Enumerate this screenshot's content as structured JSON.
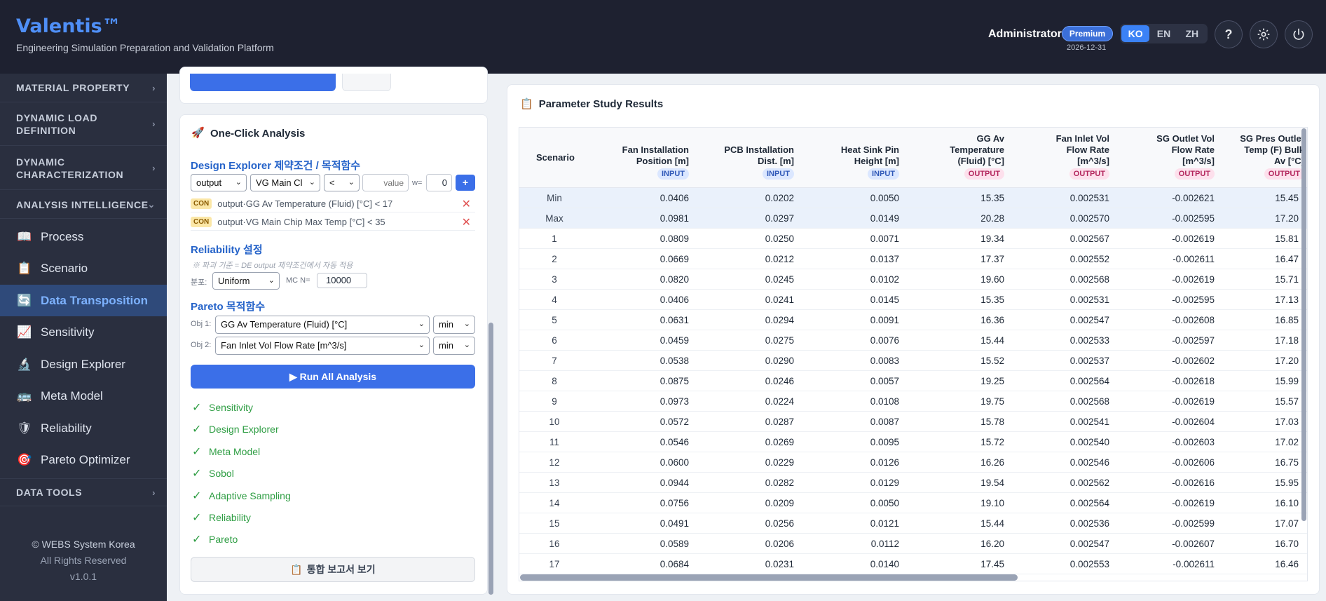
{
  "header": {
    "brand": "Valentis™",
    "subtitle": "Engineering Simulation Preparation and Validation Platform",
    "user": "Administrator",
    "plan_badge": "Premium",
    "plan_date": "2026-12-31",
    "languages": [
      "KO",
      "EN",
      "ZH"
    ],
    "active_language": "KO",
    "help_icon": "?",
    "settings_icon": "gear-icon",
    "power_icon": "power-icon"
  },
  "sidebar": {
    "sections": {
      "material": "MATERIAL PROPERTY",
      "dynamic_load": "DYNAMIC LOAD DEFINITION",
      "dynamic_char": "DYNAMIC CHARACTERIZATION",
      "analysis": "ANALYSIS INTELLIGENCE",
      "data_tools": "DATA TOOLS"
    },
    "items": [
      {
        "label": "Process",
        "icon": "book-icon"
      },
      {
        "label": "Scenario",
        "icon": "clipboard-icon"
      },
      {
        "label": "Data Transposition",
        "icon": "transpose-icon"
      },
      {
        "label": "Sensitivity",
        "icon": "chart-icon"
      },
      {
        "label": "Design Explorer",
        "icon": "microscope-icon"
      },
      {
        "label": "Meta Model",
        "icon": "bus-icon"
      },
      {
        "label": "Reliability",
        "icon": "shield-icon"
      },
      {
        "label": "Pareto Optimizer",
        "icon": "target-icon"
      }
    ],
    "active_item": "Data Transposition",
    "footer": {
      "copyright": "© WEBS System Korea",
      "rights": "All Rights Reserved",
      "version": "v1.0.1"
    }
  },
  "analysis_panel": {
    "title": "One-Click Analysis",
    "de": {
      "title": "Design Explorer 제약조건 / 목적함수",
      "type_select": "output",
      "var_select": "VG Main Cl",
      "op_select": "<",
      "value_placeholder": "value",
      "weight_label": "w=",
      "weight_value": "0",
      "add_label": "+"
    },
    "constraints": [
      {
        "badge": "CON",
        "text": "output·GG Av Temperature (Fluid) [°C] < 17"
      },
      {
        "badge": "CON",
        "text": "output·VG Main Chip Max Temp [°C] < 35"
      }
    ],
    "reliability": {
      "title": "Reliability 설정",
      "note": "※ 파괴 기준 = DE output 제약조건에서 자동 적용",
      "dist_label": "분포:",
      "dist_value": "Uniform",
      "mc_label": "MC N=",
      "mc_value": "10000"
    },
    "pareto": {
      "title": "Pareto 목적함수",
      "obj1_label": "Obj 1:",
      "obj1_value": "GG Av Temperature (Fluid) [°C]",
      "obj1_dir": "min",
      "obj2_label": "Obj 2:",
      "obj2_value": "Fan Inlet Vol Flow Rate [m^3/s]",
      "obj2_dir": "min"
    },
    "run_label": "▶ Run All Analysis",
    "checks": [
      "Sensitivity",
      "Design Explorer",
      "Meta Model",
      "Sobol",
      "Adaptive Sampling",
      "Reliability",
      "Pareto"
    ],
    "report_label": "통합 보고서 보기"
  },
  "results": {
    "title": "Parameter Study Results",
    "columns": [
      {
        "label": "Scenario",
        "tag": ""
      },
      {
        "label": "Fan Installation Position [m]",
        "tag": "INPUT"
      },
      {
        "label": "PCB Installation Dist. [m]",
        "tag": "INPUT"
      },
      {
        "label": "Heat Sink Pin Height [m]",
        "tag": "INPUT"
      },
      {
        "label": "GG Av Temperature (Fluid) [°C]",
        "tag": "OUTPUT"
      },
      {
        "label": "Fan Inlet Vol Flow Rate [m^3/s]",
        "tag": "OUTPUT"
      },
      {
        "label": "SG Outlet Vol Flow Rate [m^3/s]",
        "tag": "OUTPUT"
      },
      {
        "label": "SG Pres Outlet Temp (F) Bulk Av [°C]",
        "tag": "OUTPUT"
      }
    ],
    "stat_rows": [
      [
        "Min",
        "0.0406",
        "0.0202",
        "0.0050",
        "15.35",
        "0.002531",
        "-0.002621",
        "15.45"
      ],
      [
        "Max",
        "0.0981",
        "0.0297",
        "0.0149",
        "20.28",
        "0.002570",
        "-0.002595",
        "17.20"
      ]
    ],
    "rows": [
      [
        "1",
        "0.0809",
        "0.0250",
        "0.0071",
        "19.34",
        "0.002567",
        "-0.002619",
        "15.81"
      ],
      [
        "2",
        "0.0669",
        "0.0212",
        "0.0137",
        "17.37",
        "0.002552",
        "-0.002611",
        "16.47"
      ],
      [
        "3",
        "0.0820",
        "0.0245",
        "0.0102",
        "19.60",
        "0.002568",
        "-0.002619",
        "15.71"
      ],
      [
        "4",
        "0.0406",
        "0.0241",
        "0.0145",
        "15.35",
        "0.002531",
        "-0.002595",
        "17.13"
      ],
      [
        "5",
        "0.0631",
        "0.0294",
        "0.0091",
        "16.36",
        "0.002547",
        "-0.002608",
        "16.85"
      ],
      [
        "6",
        "0.0459",
        "0.0275",
        "0.0076",
        "15.44",
        "0.002533",
        "-0.002597",
        "17.18"
      ],
      [
        "7",
        "0.0538",
        "0.0290",
        "0.0083",
        "15.52",
        "0.002537",
        "-0.002602",
        "17.20"
      ],
      [
        "8",
        "0.0875",
        "0.0246",
        "0.0057",
        "19.25",
        "0.002564",
        "-0.002618",
        "15.99"
      ],
      [
        "9",
        "0.0973",
        "0.0224",
        "0.0108",
        "19.75",
        "0.002568",
        "-0.002619",
        "15.57"
      ],
      [
        "10",
        "0.0572",
        "0.0287",
        "0.0087",
        "15.78",
        "0.002541",
        "-0.002604",
        "17.03"
      ],
      [
        "11",
        "0.0546",
        "0.0269",
        "0.0095",
        "15.72",
        "0.002540",
        "-0.002603",
        "17.02"
      ],
      [
        "12",
        "0.0600",
        "0.0229",
        "0.0126",
        "16.26",
        "0.002546",
        "-0.002606",
        "16.75"
      ],
      [
        "13",
        "0.0944",
        "0.0282",
        "0.0129",
        "19.54",
        "0.002562",
        "-0.002616",
        "15.95"
      ],
      [
        "14",
        "0.0756",
        "0.0209",
        "0.0050",
        "19.10",
        "0.002564",
        "-0.002619",
        "16.10"
      ],
      [
        "15",
        "0.0491",
        "0.0256",
        "0.0121",
        "15.44",
        "0.002536",
        "-0.002599",
        "17.07"
      ],
      [
        "16",
        "0.0589",
        "0.0206",
        "0.0112",
        "16.20",
        "0.002547",
        "-0.002607",
        "16.70"
      ],
      [
        "17",
        "0.0684",
        "0.0231",
        "0.0140",
        "17.45",
        "0.002553",
        "-0.002611",
        "16.46"
      ]
    ]
  }
}
